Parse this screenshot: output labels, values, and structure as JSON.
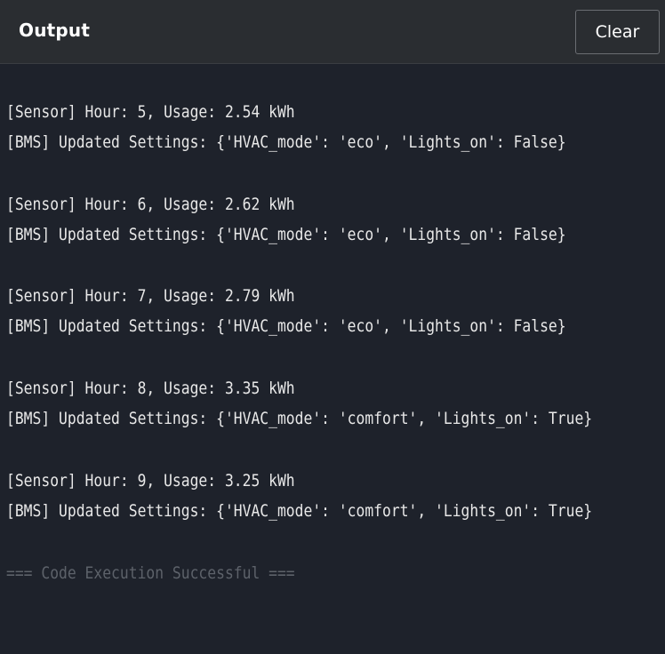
{
  "header": {
    "title": "Output",
    "clear_label": "Clear"
  },
  "console": {
    "lines": [
      "[Sensor] Hour: 5, Usage: 2.54 kWh",
      "[BMS] Updated Settings: {'HVAC_mode': 'eco', 'Lights_on': False}",
      "[Sensor] Hour: 6, Usage: 2.62 kWh",
      "[BMS] Updated Settings: {'HVAC_mode': 'eco', 'Lights_on': False}",
      "[Sensor] Hour: 7, Usage: 2.79 kWh",
      "[BMS] Updated Settings: {'HVAC_mode': 'eco', 'Lights_on': False}",
      "[Sensor] Hour: 8, Usage: 3.35 kWh",
      "[BMS] Updated Settings: {'HVAC_mode': 'comfort', 'Lights_on': True}",
      "[Sensor] Hour: 9, Usage: 3.25 kWh",
      "[BMS] Updated Settings: {'HVAC_mode': 'comfort', 'Lights_on': True}"
    ],
    "status": "=== Code Execution Successful ==="
  },
  "colors": {
    "background": "#1e222b",
    "header_background": "#2a2d31",
    "text": "#e8e8e8",
    "status_text": "#5d626a"
  }
}
